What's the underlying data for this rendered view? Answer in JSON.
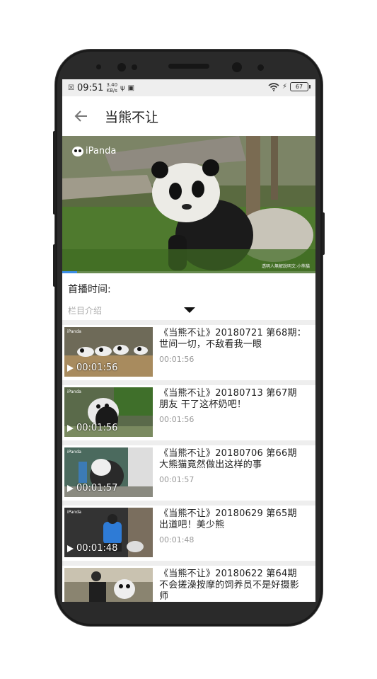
{
  "status_bar": {
    "time": "09:51",
    "net_speed_value": "3.40",
    "net_speed_unit": "KB/s",
    "battery": "67"
  },
  "app_bar": {
    "title": "当熊不让"
  },
  "player": {
    "watermark": "iPanda",
    "progress": 0.06,
    "corner_text": "透明人無解說明文:小熊貓"
  },
  "program_info": {
    "airtime_label": "首播时间:",
    "intro_label": "栏目介绍"
  },
  "episodes": [
    {
      "title": "《当熊不让》20180721 第68期：世间一切，不敌看我一眼",
      "duration": "00:01:56",
      "thumb_duration": "00:01:56"
    },
    {
      "title": "《当熊不让》20180713 第67期 朋友 干了这杯奶吧！",
      "duration": "00:01:56",
      "thumb_duration": "00:01:56"
    },
    {
      "title": "《当熊不让》20180706 第66期 大熊猫竟然做出这样的事",
      "duration": "00:01:57",
      "thumb_duration": "00:01:57"
    },
    {
      "title": "《当熊不让》20180629 第65期 出道吧！美少熊",
      "duration": "00:01:48",
      "thumb_duration": "00:01:48"
    },
    {
      "title": "《当熊不让》20180622 第64期 不会搓澡按摩的饲养员不是好摄影师",
      "duration": "",
      "thumb_duration": ""
    }
  ],
  "thumb_logo": "iPanda",
  "colors": {
    "accent": "#3b8ce5",
    "statusbar_bg": "#eeeeee",
    "phone_body": "#2a2a2a"
  }
}
